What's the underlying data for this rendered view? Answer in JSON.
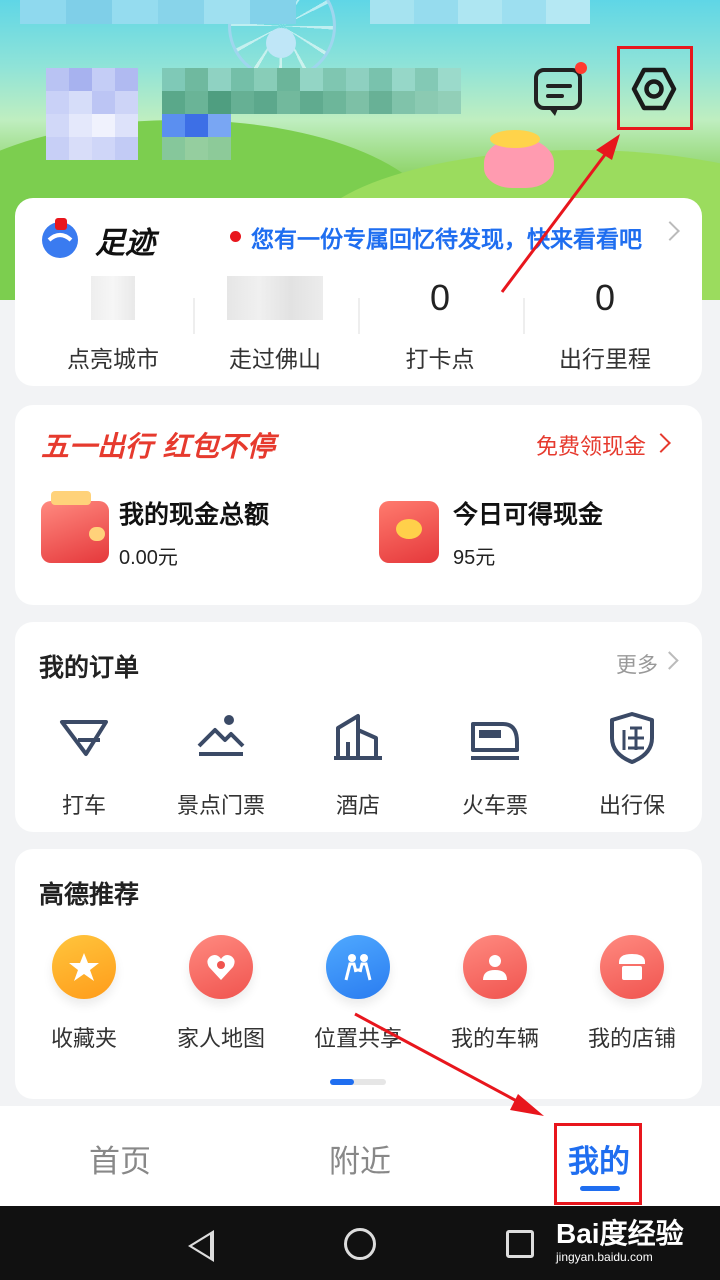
{
  "header": {
    "message_icon": "message-icon",
    "settings_icon": "settings-hexagon-icon"
  },
  "footprint": {
    "title": "足迹",
    "banner": "您有一份专属回忆待发现，快来看看吧",
    "stats": [
      {
        "value": "",
        "label": "点亮城市"
      },
      {
        "value": "",
        "label": "走过佛山"
      },
      {
        "value": "0",
        "label": "打卡点"
      },
      {
        "value": "0",
        "label": "出行里程"
      }
    ]
  },
  "promo": {
    "title": "五一出行 红包不停",
    "link": "免费领现金",
    "total_label": "我的现金总额",
    "total_value": "0.00元",
    "today_label": "今日可得现金",
    "today_value": "95元"
  },
  "orders": {
    "title": "我的订单",
    "more": "更多",
    "items": [
      {
        "label": "打车",
        "icon": "taxi-icon"
      },
      {
        "label": "景点门票",
        "icon": "scenic-ticket-icon"
      },
      {
        "label": "酒店",
        "icon": "hotel-icon"
      },
      {
        "label": "火车票",
        "icon": "train-icon"
      },
      {
        "label": "出行保",
        "icon": "insurance-shield-icon"
      }
    ]
  },
  "recommend": {
    "title": "高德推荐",
    "items": [
      {
        "label": "收藏夹",
        "icon": "star-icon"
      },
      {
        "label": "家人地图",
        "icon": "family-heart-icon"
      },
      {
        "label": "位置共享",
        "icon": "people-icon"
      },
      {
        "label": "我的车辆",
        "icon": "driver-icon"
      },
      {
        "label": "我的店铺",
        "icon": "shop-icon"
      }
    ]
  },
  "tabs": [
    {
      "label": "首页",
      "active": false
    },
    {
      "label": "附近",
      "active": false
    },
    {
      "label": "我的",
      "active": true
    }
  ],
  "watermark": {
    "main": "Bai度经验",
    "sub": "jingyan.baidu.com"
  },
  "colors": {
    "accent": "#1f6ef0",
    "promo_red": "#e63a2e",
    "highlight_red": "#e8161d"
  }
}
